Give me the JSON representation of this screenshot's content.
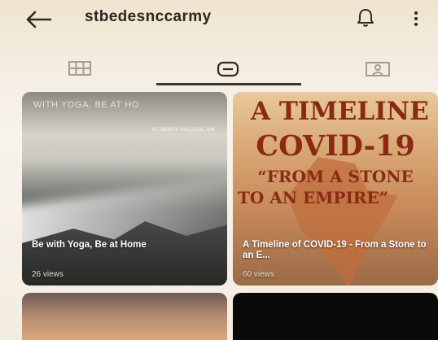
{
  "header": {
    "username": "stbedesnccarmy"
  },
  "icons": {
    "back": "back-arrow-icon",
    "bell": "bell-icon",
    "more": "more-vertical-icon",
    "tab_grid": "grid-icon",
    "tab_guides": "guides-icon",
    "tab_tagged": "tagged-icon"
  },
  "tabs": [
    {
      "id": "grid",
      "active": false
    },
    {
      "id": "guides",
      "active": true
    },
    {
      "id": "tagged",
      "active": false
    }
  ],
  "cards": [
    {
      "poster_title": "WITH YOGA, BE AT HO",
      "poster_sub": "ST. BEDE'S COLLEGE, SHI",
      "caption": "Be with Yoga, Be at Home",
      "views": "26 views"
    },
    {
      "poster_lines": [
        "A TIMELINE OI",
        "COVID-19",
        "“FROM A STONE",
        "TO AN EMPIRE”"
      ],
      "caption": "A Timeline of COVID-19 - From a Stone to an E...",
      "views": "60 views"
    }
  ],
  "colors": {
    "active_tab_indicator": "#3a342b",
    "text_dark": "#2a2620",
    "poster_red": "#8b2a14"
  }
}
